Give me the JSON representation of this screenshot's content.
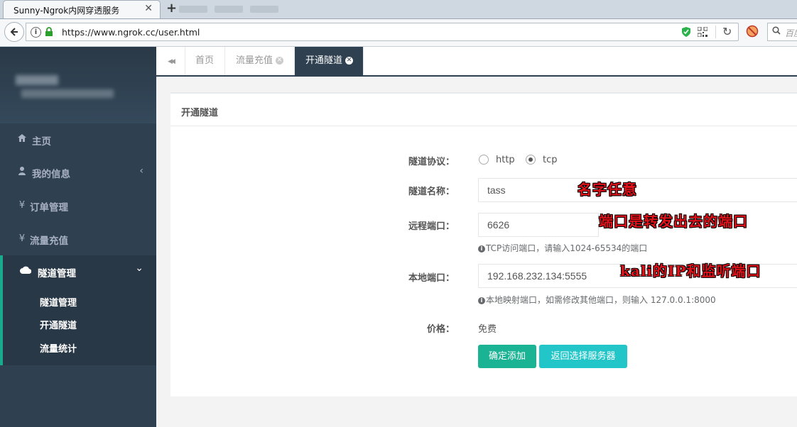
{
  "browser": {
    "tab_title": "Sunny-Ngrok内网穿透服务",
    "tab_close": "✕",
    "new_tab": "+",
    "url": "https://www.ngrok.cc/user.html",
    "search_placeholder": "百度",
    "reload": "↻"
  },
  "sidebar": {
    "items": [
      {
        "icon": "home-icon",
        "label": "主页"
      },
      {
        "icon": "user-icon",
        "label": "我的信息",
        "chevron": "‹"
      },
      {
        "icon": "yen-icon",
        "label": "订单管理",
        "glyph": "¥"
      },
      {
        "icon": "yen-icon",
        "label": "流量充值",
        "glyph": "¥"
      }
    ],
    "active": {
      "icon": "cloud-icon",
      "label": "隧道管理",
      "chevron": "⌄"
    },
    "sub_items": [
      "隧道管理",
      "开通隧道",
      "流量统计"
    ]
  },
  "tabs": {
    "back": "◀◀",
    "items": [
      {
        "label": "首页",
        "closable": false
      },
      {
        "label": "流量充值",
        "closable": true
      },
      {
        "label": "开通隧道",
        "closable": true,
        "active": true
      }
    ]
  },
  "panel": {
    "title": "开通隧道",
    "form": {
      "protocol_label": "隧道协议：",
      "protocol_options": [
        "http",
        "tcp"
      ],
      "protocol_selected": "tcp",
      "name_label": "隧道名称：",
      "name_value": "tass",
      "remote_port_label": "远程端口：",
      "remote_port_value": "6626",
      "remote_port_help": "TCP访问端口，请输入1024-65534的端口",
      "local_port_label": "本地端口：",
      "local_port_value": "192.168.232.134:5555",
      "local_port_help": "本地映射端口，如需修改其他端口，则输入 127.0.0.1:8000",
      "price_label": "价格：",
      "price_value": "免费",
      "submit_label": "确定添加",
      "back_label": "返回选择服务器"
    }
  },
  "annotations": {
    "name_note": "名字任意",
    "remote_note": "端口是转发出去的端口",
    "local_note": "kali的IP和监听端口"
  },
  "colors": {
    "sidebar_bg": "#2f4050",
    "accent_green": "#1ab394",
    "accent_cyan": "#23c6c8",
    "annotation_red": "#e0131b"
  }
}
